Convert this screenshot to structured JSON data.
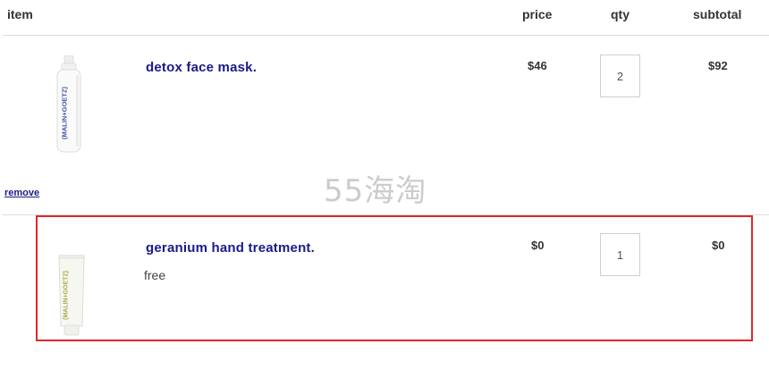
{
  "table": {
    "headers": {
      "item": "item",
      "price": "price",
      "qty": "qty",
      "subtotal": "subtotal"
    }
  },
  "cart": {
    "items": [
      {
        "name": "detox face mask.",
        "price": "$46",
        "qty": "2",
        "subtotal": "$92",
        "remove_label": "remove",
        "product_image_icon": "white-bottle-icon",
        "bottle_label": "(MALIN+GOETZ)"
      },
      {
        "name": "geranium hand treatment.",
        "note": "free",
        "price": "$0",
        "qty": "1",
        "subtotal": "$0",
        "product_image_icon": "tube-icon",
        "tube_label": "(MALIN+GOETZ)"
      }
    ]
  },
  "watermark": {
    "text": "55海淘"
  },
  "colors": {
    "product_name": "#1a1a8a",
    "highlight_border": "#e0272b",
    "divider": "#dddddd"
  }
}
